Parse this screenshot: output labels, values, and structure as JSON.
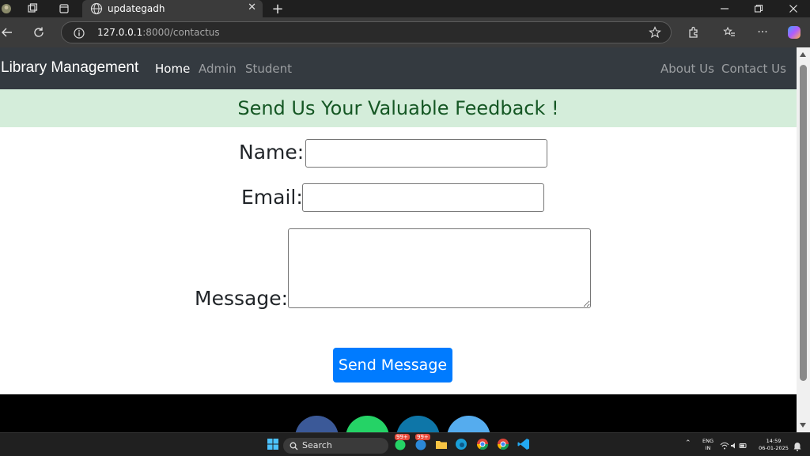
{
  "browser": {
    "tab_title": "updategadh",
    "url_host": "127.0.0.1",
    "url_path": ":8000/contactus"
  },
  "navbar": {
    "brand": "Library Management",
    "links_left": [
      "Home",
      "Admin",
      "Student"
    ],
    "links_right": [
      "About Us",
      "Contact Us"
    ]
  },
  "banner": {
    "heading": "Send Us Your Valuable Feedback !"
  },
  "form": {
    "name_label": "Name:",
    "email_label": "Email:",
    "message_label": "Message:",
    "name_value": "",
    "email_value": "",
    "message_value": "",
    "submit_label": "Send Message"
  },
  "taskbar": {
    "search_placeholder": "Search",
    "lang_line1": "ENG",
    "lang_line2": "IN",
    "time": "14:59",
    "date": "06-01-2025",
    "badge": "99+"
  },
  "colors": {
    "navbar_bg": "#343a40",
    "banner_bg": "#d4edda",
    "banner_text": "#155724",
    "primary": "#007bff"
  }
}
